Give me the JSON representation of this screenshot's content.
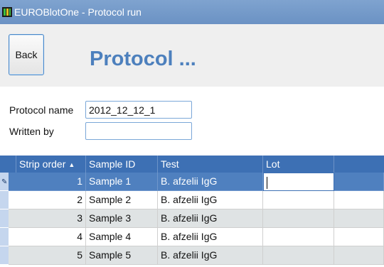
{
  "window": {
    "title": "EUROBlotOne - Protocol run"
  },
  "header": {
    "back_label": "Back",
    "page_title": "Protocol ..."
  },
  "form": {
    "protocol_name_label": "Protocol name",
    "protocol_name_value": "2012_12_12_1",
    "written_by_label": "Written by",
    "written_by_value": ""
  },
  "grid": {
    "columns": [
      "Strip order",
      "Sample ID",
      "Test",
      "Lot"
    ],
    "sort_column": "Strip order",
    "sort_direction": "ascending",
    "selected_row": 1,
    "rows": [
      {
        "strip_order": "1",
        "sample_id": "Sample 1",
        "test": "B. afzelii IgG",
        "lot": ""
      },
      {
        "strip_order": "2",
        "sample_id": "Sample 2",
        "test": "B. afzelii IgG",
        "lot": ""
      },
      {
        "strip_order": "3",
        "sample_id": "Sample 3",
        "test": "B. afzelii IgG",
        "lot": ""
      },
      {
        "strip_order": "4",
        "sample_id": "Sample 4",
        "test": "B. afzelii IgG",
        "lot": ""
      },
      {
        "strip_order": "5",
        "sample_id": "Sample 5",
        "test": "B. afzelii IgG",
        "lot": ""
      }
    ]
  },
  "colors": {
    "titlebar": "#6b92c4",
    "accent": "#4d80bd",
    "grid_header": "#3d70b4",
    "selected_row": "#4f80bf",
    "alt_row": "#dfe3e4"
  }
}
